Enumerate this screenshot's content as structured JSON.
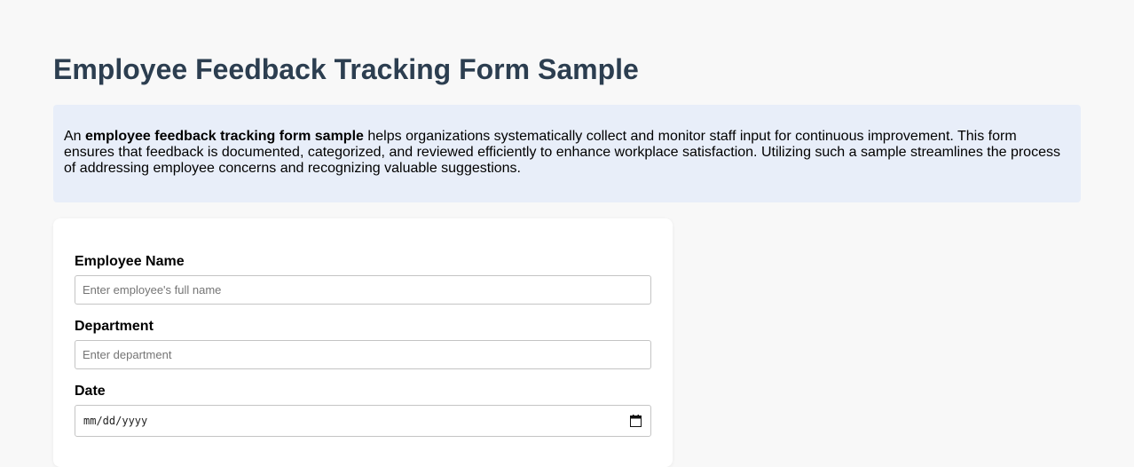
{
  "page": {
    "title": "Employee Feedback Tracking Form Sample"
  },
  "intro": {
    "prefix": "An ",
    "bold": "employee feedback tracking form sample",
    "suffix": " helps organizations systematically collect and monitor staff input for continuous improvement. This form ensures that feedback is documented, categorized, and reviewed efficiently to enhance workplace satisfaction. Utilizing such a sample streamlines the process of addressing employee concerns and recognizing valuable suggestions."
  },
  "form": {
    "employee_name": {
      "label": "Employee Name",
      "placeholder": "Enter employee's full name",
      "value": ""
    },
    "department": {
      "label": "Department",
      "placeholder": "Enter department",
      "value": ""
    },
    "date": {
      "label": "Date",
      "display": "mm/dd/yyyy",
      "icon": "calendar-icon"
    }
  },
  "colors": {
    "title": "#2c3e50",
    "intro_bg": "#e8eef9",
    "page_bg": "#f8f8f8"
  }
}
